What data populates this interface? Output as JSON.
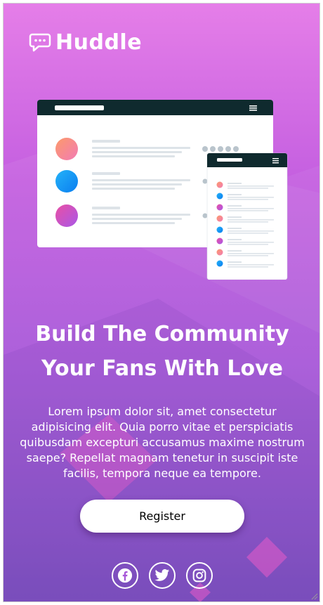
{
  "brand": {
    "name": "Huddle",
    "icon": "chat-bubble-icon"
  },
  "hero": {
    "headline_line1": "Build The Community",
    "headline_line2": "Your Fans With Love",
    "body": "Lorem ipsum dolor sit, amet consectetur adipisicing elit. Quia porro vitae et perspiciatis quibusdam excepturi accusamus maxime nostrum saepe? Repellat magnam tenetur in suscipit iste facilis, tempora neque ea tempore."
  },
  "cta": {
    "register_label": "Register"
  },
  "social": [
    {
      "name": "facebook",
      "icon": "facebook-icon"
    },
    {
      "name": "twitter",
      "icon": "twitter-icon"
    },
    {
      "name": "instagram",
      "icon": "instagram-icon"
    }
  ],
  "colors": {
    "gradient_top": "#e57ee8",
    "gradient_bottom": "#7748bd",
    "mockup_header": "#0f2a2e",
    "text": "#ffffff"
  }
}
